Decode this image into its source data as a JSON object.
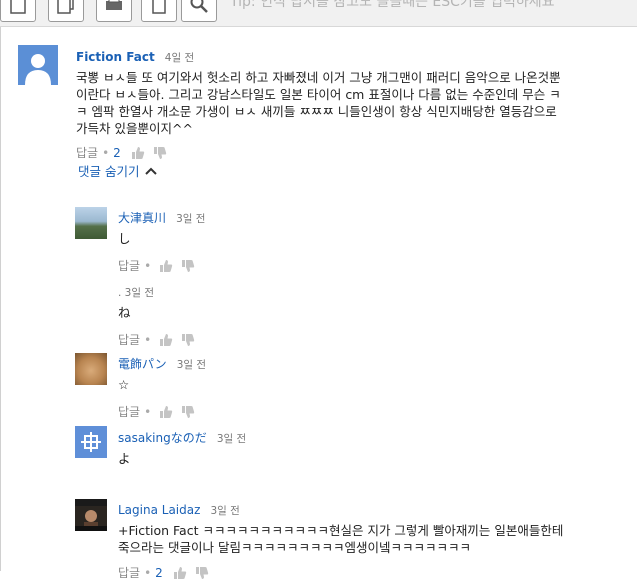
{
  "toolbar": {
    "hint": "Tip: 인식 답서를 참고도 쓸을때는 ESC키를 입력하세요"
  },
  "comments": [
    {
      "author": "Fiction Fact",
      "time": "4일 전",
      "text": [
        "국뽕 ㅂㅅ들 또 여기와서 헛소리 하고 자빠졌네 이거 그냥 개그맨이 패러디 음악으로 나온것뿐",
        "이란다 ㅂㅅ들아. 그리고 강남스타일도 일본 타이어 cm 표절이나 다름 없는 수준인데 무슨 ㅋ",
        "ㅋ 엠팍 한열사 개소문 가생이 ㅂㅅ 새끼들 ㅉㅉㅉ 니들인생이 항상 식민지배당한 열등감으로",
        "가득차 있을뿐이지^^"
      ],
      "reply_label": "답글",
      "likes": "2"
    }
  ],
  "hide_replies_label": "댓글 숨기기",
  "replies": [
    {
      "author": "大津真川",
      "time": "3일 전",
      "text": "し",
      "reply_label": "답글",
      "likes": ""
    },
    {
      "author": "",
      "time": ". 3일 전",
      "text": "ね",
      "reply_label": "답글",
      "likes": ""
    },
    {
      "author": "電飾パン",
      "time": "3일 전",
      "text": "☆",
      "reply_label": "답글",
      "likes": ""
    },
    {
      "author": "sasakingなのだ",
      "time": "3일 전",
      "text": "よ",
      "reply_label": "답글",
      "likes": ""
    },
    {
      "author": "Lagina Laidaz",
      "time": "3일 전",
      "text": [
        "+Fiction Fact ㅋㅋㅋㅋㅋㅋㅋㅋㅋㅋㅋ현실은 지가 그렇게 빨아재끼는 일본애들한테",
        "죽으라는 댓글이나 달림ㅋㅋㅋㅋㅋㅋㅋㅋㅋ엠생이넼ㅋㅋㅋㅋㅋㅋㅋ"
      ],
      "reply_label": "답글",
      "likes": "2"
    }
  ],
  "colors": {
    "link": "#1a60b5",
    "meta": "#888888",
    "border": "#d0d0d0"
  }
}
